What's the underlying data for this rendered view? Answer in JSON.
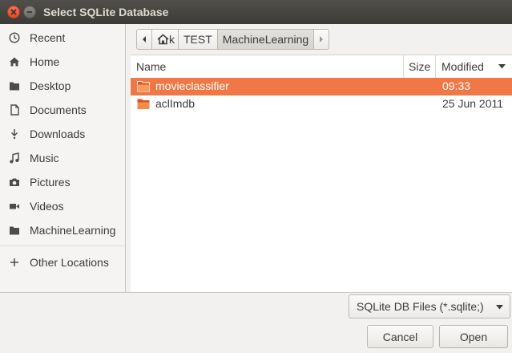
{
  "window": {
    "title": "Select SQLite Database"
  },
  "sidebar": {
    "items": [
      {
        "label": "Recent",
        "icon": "clock-icon"
      },
      {
        "label": "Home",
        "icon": "home-icon"
      },
      {
        "label": "Desktop",
        "icon": "folder-icon"
      },
      {
        "label": "Documents",
        "icon": "document-icon"
      },
      {
        "label": "Downloads",
        "icon": "download-icon"
      },
      {
        "label": "Music",
        "icon": "music-icon"
      },
      {
        "label": "Pictures",
        "icon": "camera-icon"
      },
      {
        "label": "Videos",
        "icon": "video-icon"
      },
      {
        "label": "MachineLearning",
        "icon": "folder-icon"
      },
      {
        "label": "Other Locations",
        "icon": "plus-icon"
      }
    ]
  },
  "pathbar": {
    "home_suffix": "k",
    "crumbs": [
      "TEST",
      "MachineLearning"
    ]
  },
  "filelist": {
    "columns": {
      "name": "Name",
      "size": "Size",
      "modified": "Modified"
    },
    "rows": [
      {
        "name": "movieclassifier",
        "size": "",
        "modified": "09:33",
        "selected": true
      },
      {
        "name": "aclImdb",
        "size": "",
        "modified": "25 Jun 2011",
        "selected": false
      }
    ]
  },
  "filter": {
    "selected": "SQLite DB Files (*.sqlite;)"
  },
  "buttons": {
    "cancel": "Cancel",
    "open": "Open"
  },
  "colors": {
    "selection": "#f07746",
    "titlebar": "#3c3b37",
    "close": "#de4c2c"
  }
}
